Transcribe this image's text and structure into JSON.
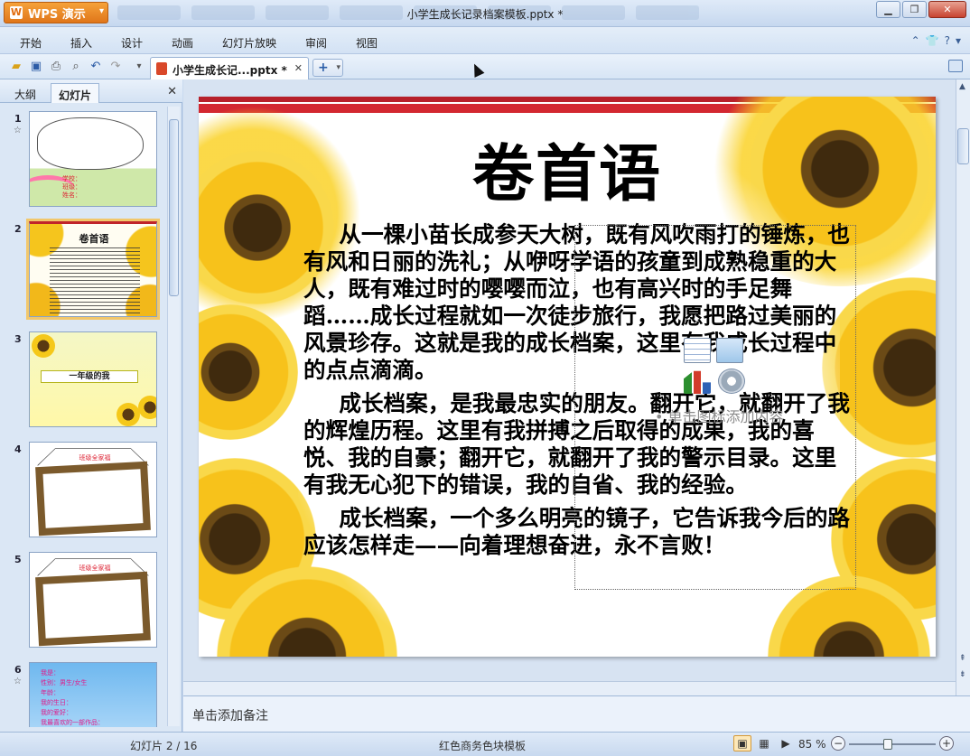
{
  "app": {
    "name": "WPS 演示",
    "window_title": "小学生成长记录档案模板.pptx *"
  },
  "menu": [
    "开始",
    "插入",
    "设计",
    "动画",
    "幻灯片放映",
    "审阅",
    "视图"
  ],
  "document_tab": {
    "label": "小学生成长记...pptx *"
  },
  "panel": {
    "tabs": [
      "大纲",
      "幻灯片"
    ],
    "active_tab": "幻灯片"
  },
  "thumbnails": [
    {
      "number": "1",
      "has_animation": true,
      "lines": [
        "学校：",
        "班级：",
        "姓名："
      ]
    },
    {
      "number": "2",
      "has_animation": false,
      "title": "卷首语",
      "selected": true
    },
    {
      "number": "3",
      "has_animation": false,
      "title": "一年级的我"
    },
    {
      "number": "4",
      "has_animation": false,
      "title": "班级全家福"
    },
    {
      "number": "5",
      "has_animation": false,
      "title": "班级全家福"
    },
    {
      "number": "6",
      "has_animation": true,
      "lines": [
        "我是：",
        "性别：男生/女生",
        "年龄：",
        "我的生日：",
        "我的爱好：",
        "我最喜欢的一部作品："
      ]
    }
  ],
  "slide": {
    "title": "卷首语",
    "paragraphs": [
      "从一棵小苗长成参天大树，既有风吹雨打的锤炼，也有风和日丽的洗礼；从咿呀学语的孩童到成熟稳重的大人，既有难过时的嘤嘤而泣，也有高兴时的手足舞蹈……成长过程就如一次徒步旅行，我愿把路过美丽的风景珍存。这就是我的成长档案，这里有我成长过程中的点点滴滴。",
      "成长档案，是我最忠实的朋友。翻开它，就翻开了我的辉煌历程。这里有我拼搏之后取得的成果，我的喜悦、我的自豪；翻开它，就翻开了我的警示目录。这里有我无心犯下的错误，我的自省、我的经验。",
      "成长档案，一个多么明亮的镜子，它告诉我今后的路应该怎样走——向着理想奋进，永不言败！"
    ],
    "placeholder_text": "单击图标添加内容"
  },
  "notes": {
    "placeholder": "单击添加备注"
  },
  "status": {
    "slide_position": "幻灯片 2 / 16",
    "template": "红色商务色块模板",
    "zoom": "85 %",
    "zoom_level": 0.45
  }
}
